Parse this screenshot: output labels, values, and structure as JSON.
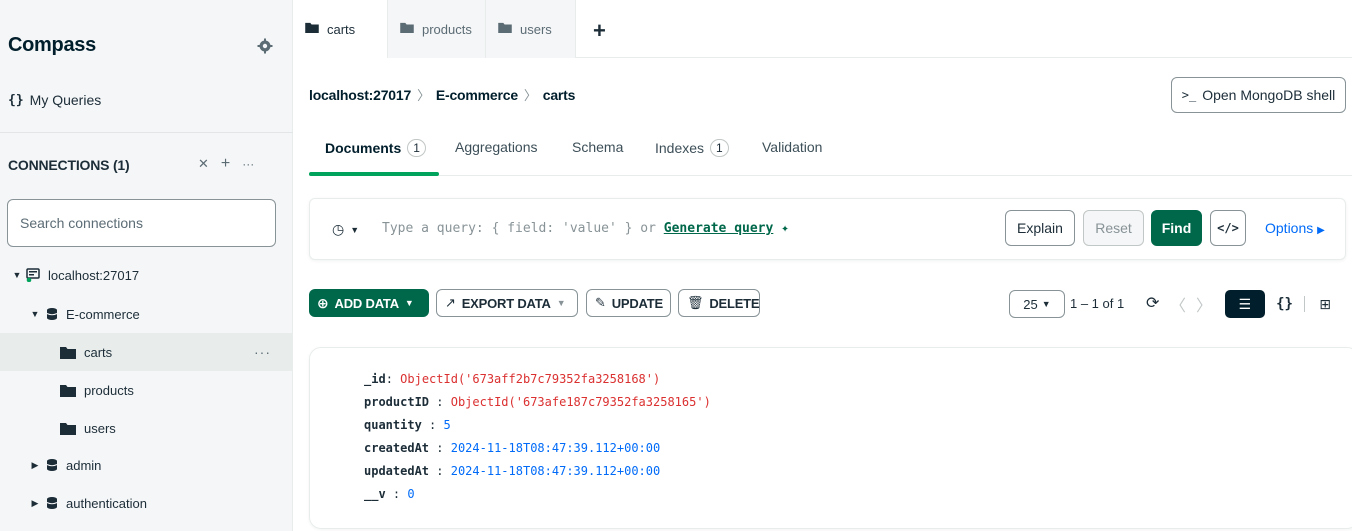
{
  "sidebar": {
    "brand": "Compass",
    "my_queries": "My Queries",
    "connections_title": "CONNECTIONS (1)",
    "search_placeholder": "Search connections",
    "host": "localhost:27017",
    "databases": [
      {
        "name": "E-commerce",
        "expanded": true,
        "collections": [
          "carts",
          "products",
          "users"
        ]
      },
      {
        "name": "admin",
        "expanded": false
      },
      {
        "name": "authentication",
        "expanded": false
      }
    ],
    "selected_collection": "carts"
  },
  "tabs": [
    {
      "label": "carts",
      "active": true
    },
    {
      "label": "products",
      "active": false
    },
    {
      "label": "users",
      "active": false
    }
  ],
  "breadcrumb": [
    "localhost:27017",
    "E-commerce",
    "carts"
  ],
  "shell_button": "Open MongoDB shell",
  "subtabs": [
    {
      "label": "Documents",
      "count": "1",
      "active": true
    },
    {
      "label": "Aggregations"
    },
    {
      "label": "Schema"
    },
    {
      "label": "Indexes",
      "count": "1"
    },
    {
      "label": "Validation"
    }
  ],
  "query": {
    "placeholder": "Type a query: { field: 'value' } or",
    "generate": "Generate query",
    "explain": "Explain",
    "reset": "Reset",
    "find": "Find",
    "options": "Options"
  },
  "toolbar": {
    "add_data": "ADD DATA",
    "export_data": "EXPORT DATA",
    "update": "UPDATE",
    "delete": "DELETE",
    "page_size": "25",
    "range": "1 – 1 of 1"
  },
  "document": {
    "fields": [
      {
        "key": "_id",
        "value": "ObjectId('673aff2b7c79352fa3258168')",
        "type": "oid"
      },
      {
        "key": "productID",
        "value": "ObjectId('673afe187c79352fa3258165')",
        "type": "oid"
      },
      {
        "key": "quantity",
        "value": "5",
        "type": "num"
      },
      {
        "key": "createdAt",
        "value": "2024-11-18T08:47:39.112+00:00",
        "type": "date"
      },
      {
        "key": "updatedAt",
        "value": "2024-11-18T08:47:39.112+00:00",
        "type": "date"
      },
      {
        "key": "__v",
        "value": "0",
        "type": "num"
      }
    ]
  },
  "colors": {
    "accent_green": "#00684a",
    "tab_underline": "#00a35c",
    "link_blue": "#016bf8",
    "oid_red": "#db3030"
  }
}
